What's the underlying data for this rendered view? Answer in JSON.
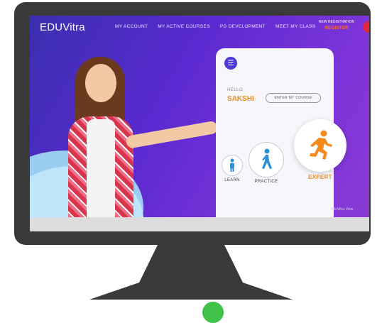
{
  "colors": {
    "monitor": "#3a3a3a",
    "screen_gradient_start": "#3b2fb0",
    "screen_gradient_end": "#8a3ad6",
    "accent_orange": "#f28a1e",
    "accent_blue": "#4f3bd6",
    "register_red": "#e0273a"
  },
  "logo": "EDUVitra",
  "nav": {
    "items": [
      "MY ACCOUNT",
      "MY ACTIVE COURSES",
      "PD DEVELOPMENT",
      "MEET MY CLASS"
    ],
    "register_top": "NEW REGISTRATION",
    "register_label": "REGISTER"
  },
  "phone": {
    "menu_icon": "hamburger-icon",
    "greeting": "HELLO",
    "user_name": "SAKSHI",
    "enter_course": "ENTER MY COURSE",
    "levels": [
      {
        "label": "LEARN",
        "icon": "standing-person-icon"
      },
      {
        "label": "PRACTICE",
        "icon": "walking-person-icon"
      },
      {
        "label": "EXPERT",
        "icon": "running-person-icon"
      }
    ]
  },
  "watermark": "EduVitra View"
}
